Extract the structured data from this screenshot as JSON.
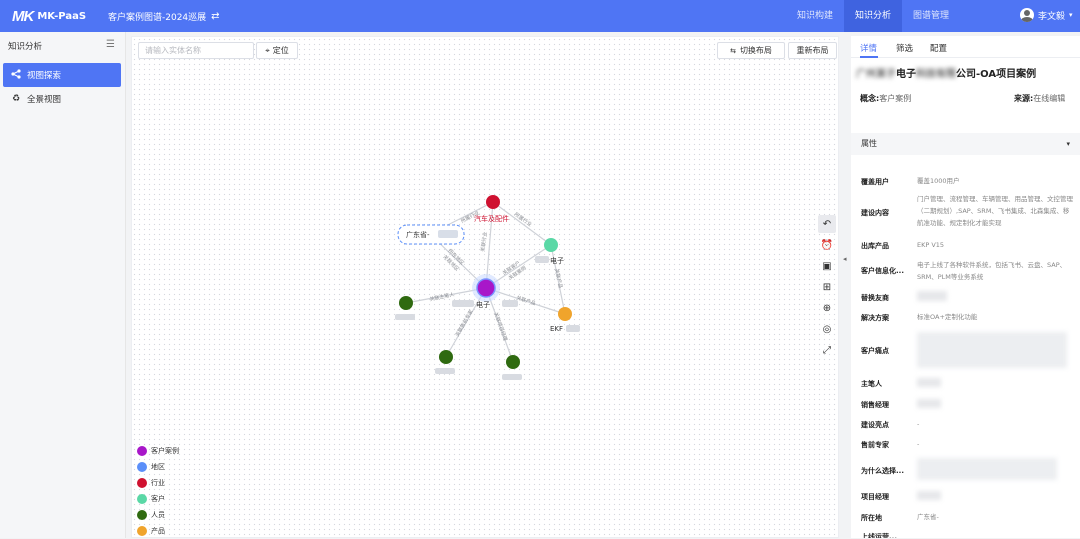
{
  "topbar": {
    "logo_mark": "MK",
    "app_name": "MK-PaaS",
    "project_title": "客户案例图谱-2024巡展",
    "nav_tabs": [
      {
        "label": "知识构建",
        "active": false
      },
      {
        "label": "知识分析",
        "active": true
      },
      {
        "label": "图谱管理",
        "active": false
      }
    ],
    "user_name": "李文毅"
  },
  "sidebar": {
    "title": "知识分析",
    "items": [
      {
        "label": "视图探索",
        "active": true,
        "icon": "share-nodes-icon"
      },
      {
        "label": "全景视图",
        "active": false,
        "icon": "recycle-icon"
      }
    ]
  },
  "canvas": {
    "search_placeholder": "请输入实体名称",
    "locate_label": "定位",
    "switch_layout_label": "切换布局",
    "relayout_label": "重新布局",
    "nodes": {
      "center": "电子",
      "industry": "汽车及配件",
      "customer": "电子",
      "region": "广东省-",
      "product": "EKF",
      "person_1": "",
      "person_2": "",
      "person_3": ""
    },
    "edge_labels": {
      "e1": "所属行业",
      "e2": "所属行业",
      "e3": "关联行业",
      "e4": "关联客户",
      "e5": "关联案例",
      "e6": "所在地区",
      "e7": "关联地区",
      "e8": "关联产品",
      "e9": "关联主笔人",
      "e10": "关联售前专家",
      "e11": "关联项目经理"
    },
    "legend": [
      {
        "label": "客户案例",
        "color": "#a817c9"
      },
      {
        "label": "地区",
        "color": "#5b8ff9"
      },
      {
        "label": "行业",
        "color": "#cf1130"
      },
      {
        "label": "客户",
        "color": "#5ad8a6"
      },
      {
        "label": "人员",
        "color": "#2f6a10"
      },
      {
        "label": "产品",
        "color": "#f0a42c"
      }
    ],
    "tools": [
      "undo-icon",
      "alarm-icon",
      "image-icon",
      "grid-image-icon",
      "zoom-in-icon",
      "focus-icon",
      "fullscreen-icon"
    ]
  },
  "right_panel": {
    "tabs": [
      {
        "label": "详情",
        "active": true
      },
      {
        "label": "筛选",
        "active": false
      },
      {
        "label": "配置",
        "active": false
      }
    ],
    "title_prefix": "广州",
    "title_blur_1": "某子",
    "title_mid": "电子",
    "title_blur_2": "科技有限",
    "title_suffix": "公司-OA项目案例",
    "concept_label": "概念:",
    "concept_value": "客户案例",
    "source_label": "来源:",
    "source_value": "在线编辑",
    "section_title": "属性",
    "attributes": [
      {
        "key": "覆盖用户",
        "value": "覆盖1000用户"
      },
      {
        "key": "建设内容",
        "value": "门户管理、流程管理、车辆管理、用品管理、文控管理（二期规划）,SAP、SRM、飞书集成、北森集成、移航准功能、规定制化才能实现"
      },
      {
        "key": "出库产品",
        "value": "EKP V15"
      },
      {
        "key": "客户信息化...",
        "value": "电子上线了各种软件系统，包括飞书、云盘、SAP、SRM、PLM等业务系统"
      },
      {
        "key": "替换友商",
        "value": ""
      },
      {
        "key": "解决方案",
        "value": "标准OA+定制化功能"
      },
      {
        "key": "客户痛点",
        "value": ""
      },
      {
        "key": "主笔人",
        "value": ""
      },
      {
        "key": "销售经理",
        "value": ""
      },
      {
        "key": "建设亮点",
        "value": "-"
      },
      {
        "key": "售前专家",
        "value": "-"
      },
      {
        "key": "为什么选择...",
        "value": ""
      },
      {
        "key": "项目经理",
        "value": ""
      },
      {
        "key": "所在地",
        "value": "广东省-"
      },
      {
        "key": "上线运营...",
        "value": ""
      }
    ]
  }
}
